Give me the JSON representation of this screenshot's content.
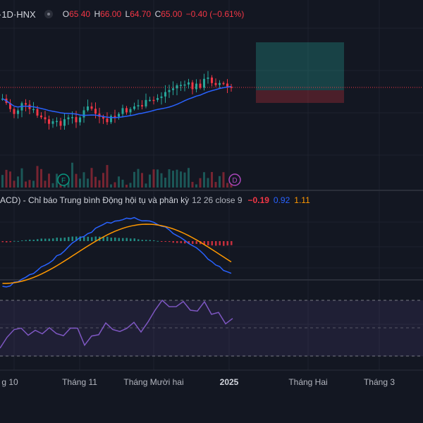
{
  "header": {
    "symbol": "·1D·HNX",
    "ohlc": {
      "o_label": "O",
      "o": "65.40",
      "h_label": "H",
      "h": "66.00",
      "l_label": "L",
      "l": "64.70",
      "c_label": "C",
      "c": "65.00",
      "change": "−0.40 (−0.61%)"
    }
  },
  "event_markers": {
    "f": "F",
    "d": "D"
  },
  "macd": {
    "title": "ACD) - Chỉ báo Trung bình Động hội tụ và phân kỳ",
    "params": "12 26 close 9",
    "macd_value": "−0.19",
    "signal_value": "0.92",
    "hist_value": "1.11"
  },
  "time_axis": [
    "g 10",
    "Tháng 11",
    "Tháng Mười hai",
    "2025",
    "Tháng Hai",
    "Tháng 3"
  ],
  "colors": {
    "background": "#131722",
    "up": "#26a69a",
    "down": "#f23645",
    "ma": "#2962ff",
    "signal": "#ff9800",
    "rsi": "#7e57c2"
  }
}
